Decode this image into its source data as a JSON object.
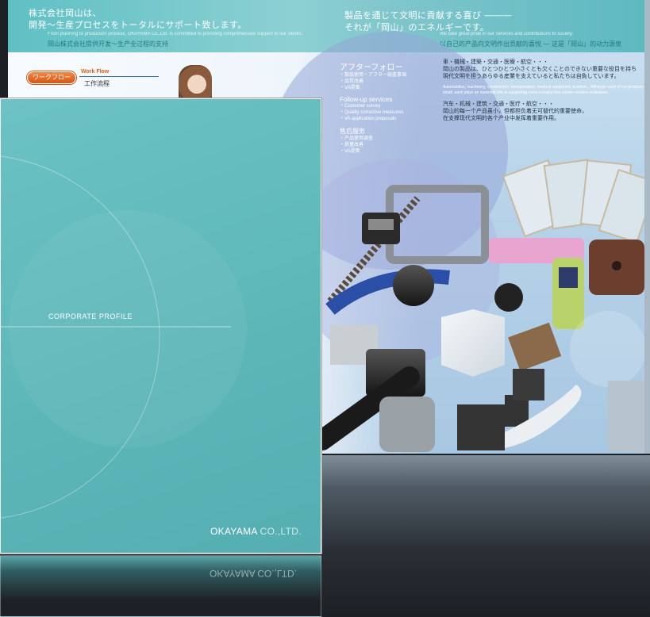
{
  "spread": {
    "banner": {
      "left_title_line1": "株式会社岡山は、",
      "left_title_line2": "開発～生産プロセスをトータルにサポート致します。",
      "left_sub_en": "From planning to production process, OKAYAMA Co.,Ltd. is committed to providing comprehensive support to our clients.",
      "left_sub_cn": "岡山株式会社提供开发～生产全过程的支持",
      "right_title_line1": "製品を通じて文明に貢献する喜び ―――",
      "right_title_line2": "それが「岡山」のエネルギーです。",
      "right_sub_en": "We take great pride in our services and contributions to society.",
      "right_sub_cn": "以自己的产品向文明作出贡献的喜悦 ― 这是「岡山」的动力源泉"
    },
    "workflow": {
      "pill_label": "ワークフロー",
      "en_label": "Work Flow",
      "zh_label": "工作流程"
    },
    "middle": {
      "heading": "アフターフォロー",
      "items_jp": [
        "・製品使用・アフター調査事項",
        "・品質改善",
        "・VA提案"
      ],
      "heading_en": "Follow-up services",
      "items_en": [
        "・Customer survey",
        "・Quality corrective measures",
        "・VA application proposals"
      ],
      "heading_cn": "售后服务",
      "items_cn": [
        "・产品使用调查",
        "・质量改善",
        "・VA提案"
      ]
    },
    "right": {
      "p1_line1": "車・機械・建築・交通・医療・航空・・・",
      "p1_line2": "岡山の製品は、ひとつひとつ小さくとも欠くことのできない重要な役目を持ち",
      "p1_line3": "現代文明を担うあらゆる産業を支えていると私たちは自負しています。",
      "p1_en": "Automobiles, machinery, construction, transportation, medical equipment, aviation... Although each of our products is small, each plays an essential role in supporting every industry that carries modern civilization.",
      "p2_line1": "汽车・机械・建筑・交通・医疗・航空・・・",
      "p2_line2": "岡山的每一个产品虽小，但都担负着无可替代的重要使命，",
      "p2_line3": "在支撑现代文明的各个产业中发挥着重要作用。"
    }
  },
  "cover": {
    "label": "CORPORATE PROFILE",
    "company_bold": "OKAYAMA",
    "company_thin": " CO.,LTD."
  },
  "colors": {
    "cover_teal": "#5cb6b8",
    "banner_teal": "#6cc4c8",
    "pill_orange": "#e06a22",
    "background": "#1d2025"
  }
}
